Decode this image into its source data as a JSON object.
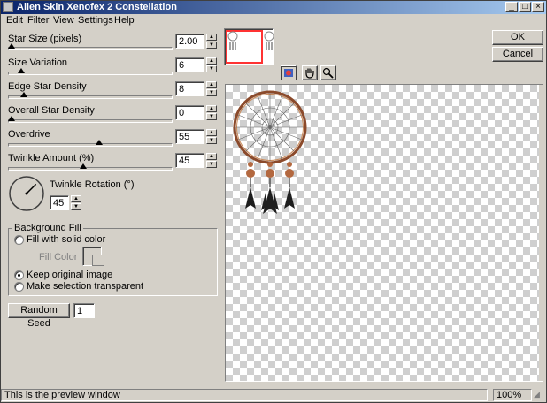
{
  "window": {
    "title": "Alien Skin Xenofex 2 Constellation",
    "minimize": "_",
    "maximize": "□",
    "close": "×"
  },
  "menu": [
    "Edit",
    "Filter",
    "View",
    "Settings",
    "Help"
  ],
  "params": {
    "star_size": {
      "label": "Star Size (pixels)",
      "value": "2.00",
      "slider": 0.0
    },
    "size_variation": {
      "label": "Size Variation",
      "value": "6",
      "slider": 0.06
    },
    "edge_star_density": {
      "label": "Edge Star Density",
      "value": "8",
      "slider": 0.08
    },
    "overall_star_density": {
      "label": "Overall Star Density",
      "value": "0",
      "slider": 0.0
    },
    "overdrive": {
      "label": "Overdrive",
      "value": "55",
      "slider": 0.55
    },
    "twinkle_amount": {
      "label": "Twinkle Amount (%)",
      "value": "45",
      "slider": 0.45
    }
  },
  "twinkle_rotation": {
    "label": "Twinkle Rotation (°)",
    "value": "45",
    "angle_degrees": 45
  },
  "background_fill": {
    "title": "Background Fill",
    "fill_solid": "Fill with solid color",
    "fill_color_label": "Fill Color",
    "keep_original": "Keep original image",
    "make_transparent": "Make selection transparent",
    "selected": "keep_original"
  },
  "random_seed": {
    "button": "Random Seed",
    "value": "1"
  },
  "buttons": {
    "ok": "OK",
    "cancel": "Cancel"
  },
  "status": {
    "message": "This is the preview window",
    "zoom": "100%"
  },
  "icons": {
    "tools": [
      "preview-toggle-icon",
      "hand-icon",
      "zoom-icon"
    ]
  },
  "colors": {
    "title_start": "#0a246a",
    "title_end": "#a6caf0",
    "face": "#d4d0c8",
    "thumbnail_highlight": "#ff3333"
  }
}
